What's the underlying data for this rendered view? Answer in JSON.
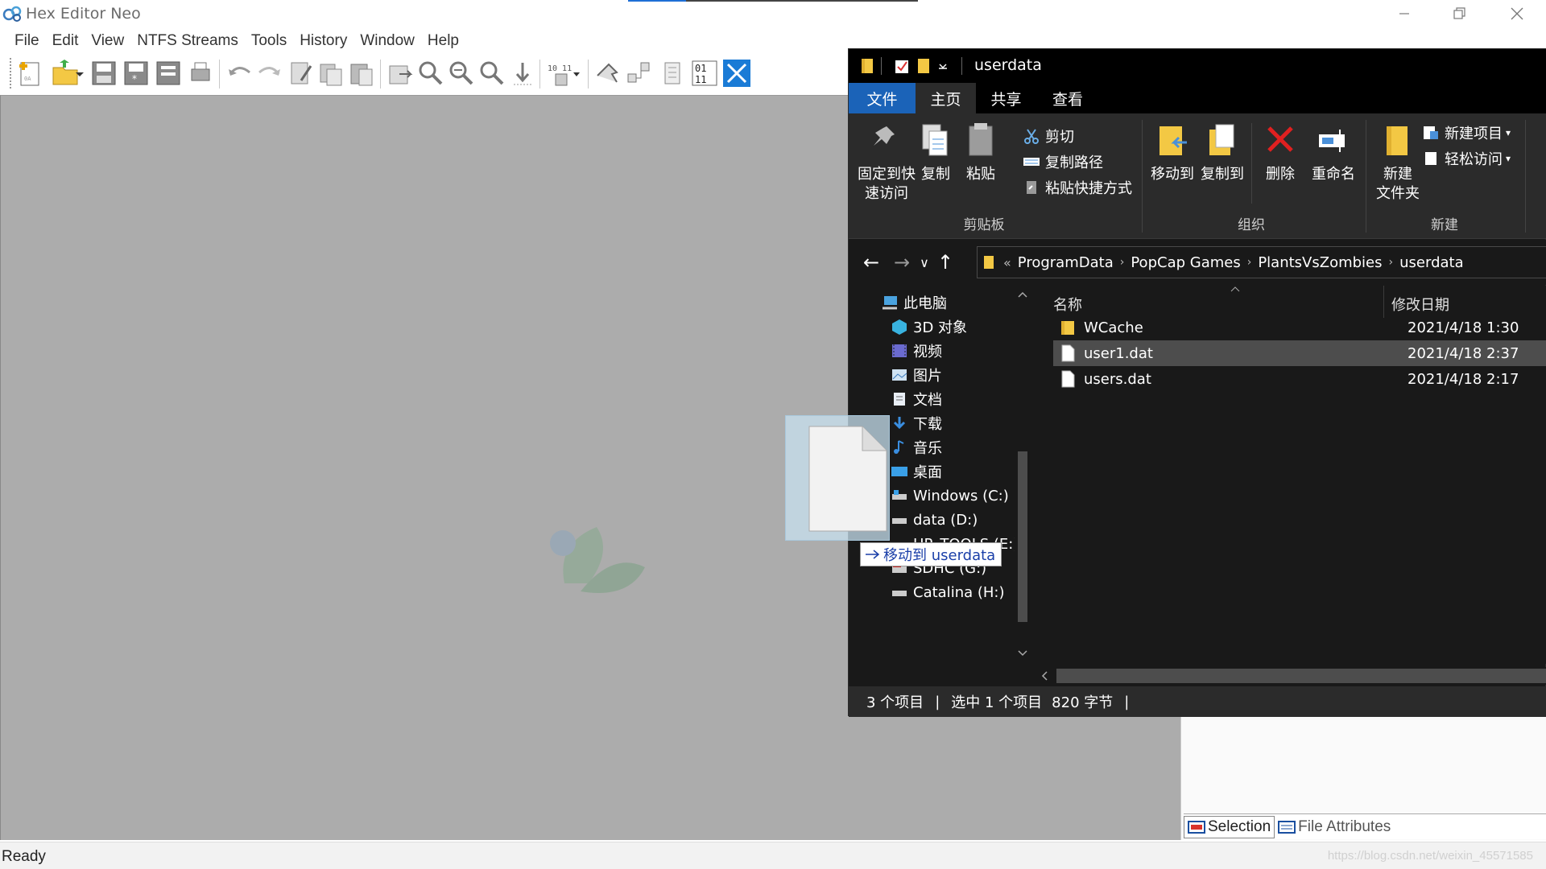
{
  "hex_editor": {
    "title": "Hex Editor Neo",
    "menu": [
      "File",
      "Edit",
      "View",
      "NTFS Streams",
      "Tools",
      "History",
      "Window",
      "Help"
    ],
    "status": "Ready",
    "panel_tabs": [
      {
        "label": "Selection",
        "icon": "selection-icon"
      },
      {
        "label": "File Attributes",
        "icon": "file-attributes-icon"
      }
    ],
    "toolbar_icons": [
      "new-file-icon",
      "open-file-icon",
      "save-icon",
      "save-all-icon",
      "save-as-icon",
      "print-icon",
      "undo-icon",
      "redo-icon",
      "edit-icon",
      "copy-icon",
      "paste-icon",
      "export-icon",
      "find-icon",
      "find-next-icon",
      "find-prev-icon",
      "goto-icon",
      "columns-icon",
      "pointer-icon",
      "structure-icon",
      "patterns-icon",
      "binary-icon",
      "fullscreen-icon"
    ]
  },
  "watermark": "https://blog.csdn.net/weixin_45571585",
  "explorer": {
    "title": "userdata",
    "ribbon_tabs": [
      "文件",
      "主页",
      "共享",
      "查看"
    ],
    "clipboard": {
      "pin": [
        "固定到快",
        "速访问"
      ],
      "copy": "复制",
      "paste": "粘贴",
      "cut": "剪切",
      "copy_path": "复制路径",
      "paste_shortcut": "粘贴快捷方式",
      "group": "剪贴板"
    },
    "organize": {
      "move_to": "移动到",
      "copy_to": "复制到",
      "delete": "删除",
      "rename": "重命名",
      "group": "组织"
    },
    "new": {
      "new_folder": [
        "新建",
        "文件夹"
      ],
      "new_item": "新建项目",
      "easy_access": "轻松访问",
      "group": "新建"
    },
    "address": {
      "prefix": "«",
      "crumbs": [
        "ProgramData",
        "PopCap Games",
        "PlantsVsZombies",
        "userdata"
      ]
    },
    "nav_tree": [
      {
        "label": "此电脑",
        "icon": "computer-icon"
      },
      {
        "label": "3D 对象",
        "icon": "3d-objects-icon"
      },
      {
        "label": "视频",
        "icon": "videos-icon"
      },
      {
        "label": "图片",
        "icon": "pictures-icon"
      },
      {
        "label": "文档",
        "icon": "documents-icon"
      },
      {
        "label": "下载",
        "icon": "downloads-icon"
      },
      {
        "label": "音乐",
        "icon": "music-icon"
      },
      {
        "label": "桌面",
        "icon": "desktop-icon"
      },
      {
        "label": "Windows (C:)",
        "icon": "drive-icon"
      },
      {
        "label": "data (D:)",
        "icon": "drive-icon"
      },
      {
        "label": "HP_TOOLS (E:)",
        "icon": "drive-icon"
      },
      {
        "label": "SDHC (G:)",
        "icon": "sd-card-icon"
      },
      {
        "label": "Catalina (H:)",
        "icon": "drive-icon"
      }
    ],
    "columns": {
      "name": "名称",
      "modified": "修改日期"
    },
    "files": [
      {
        "name": "WCache",
        "date": "2021/4/18 1:30",
        "type": "folder",
        "selected": false
      },
      {
        "name": "user1.dat",
        "date": "2021/4/18 2:37",
        "type": "file",
        "selected": true
      },
      {
        "name": "users.dat",
        "date": "2021/4/18 2:17",
        "type": "file",
        "selected": false
      }
    ],
    "status": {
      "count": "3 个项目",
      "selected": "选中 1 个项目",
      "size": "820 字节"
    }
  },
  "drag": {
    "tooltip": "移动到 userdata"
  },
  "colors": {
    "accent": "#1b63b8",
    "explorer_bg": "#191919",
    "ribbon_bg": "#2b2b2b",
    "workspace": "#acacac"
  }
}
